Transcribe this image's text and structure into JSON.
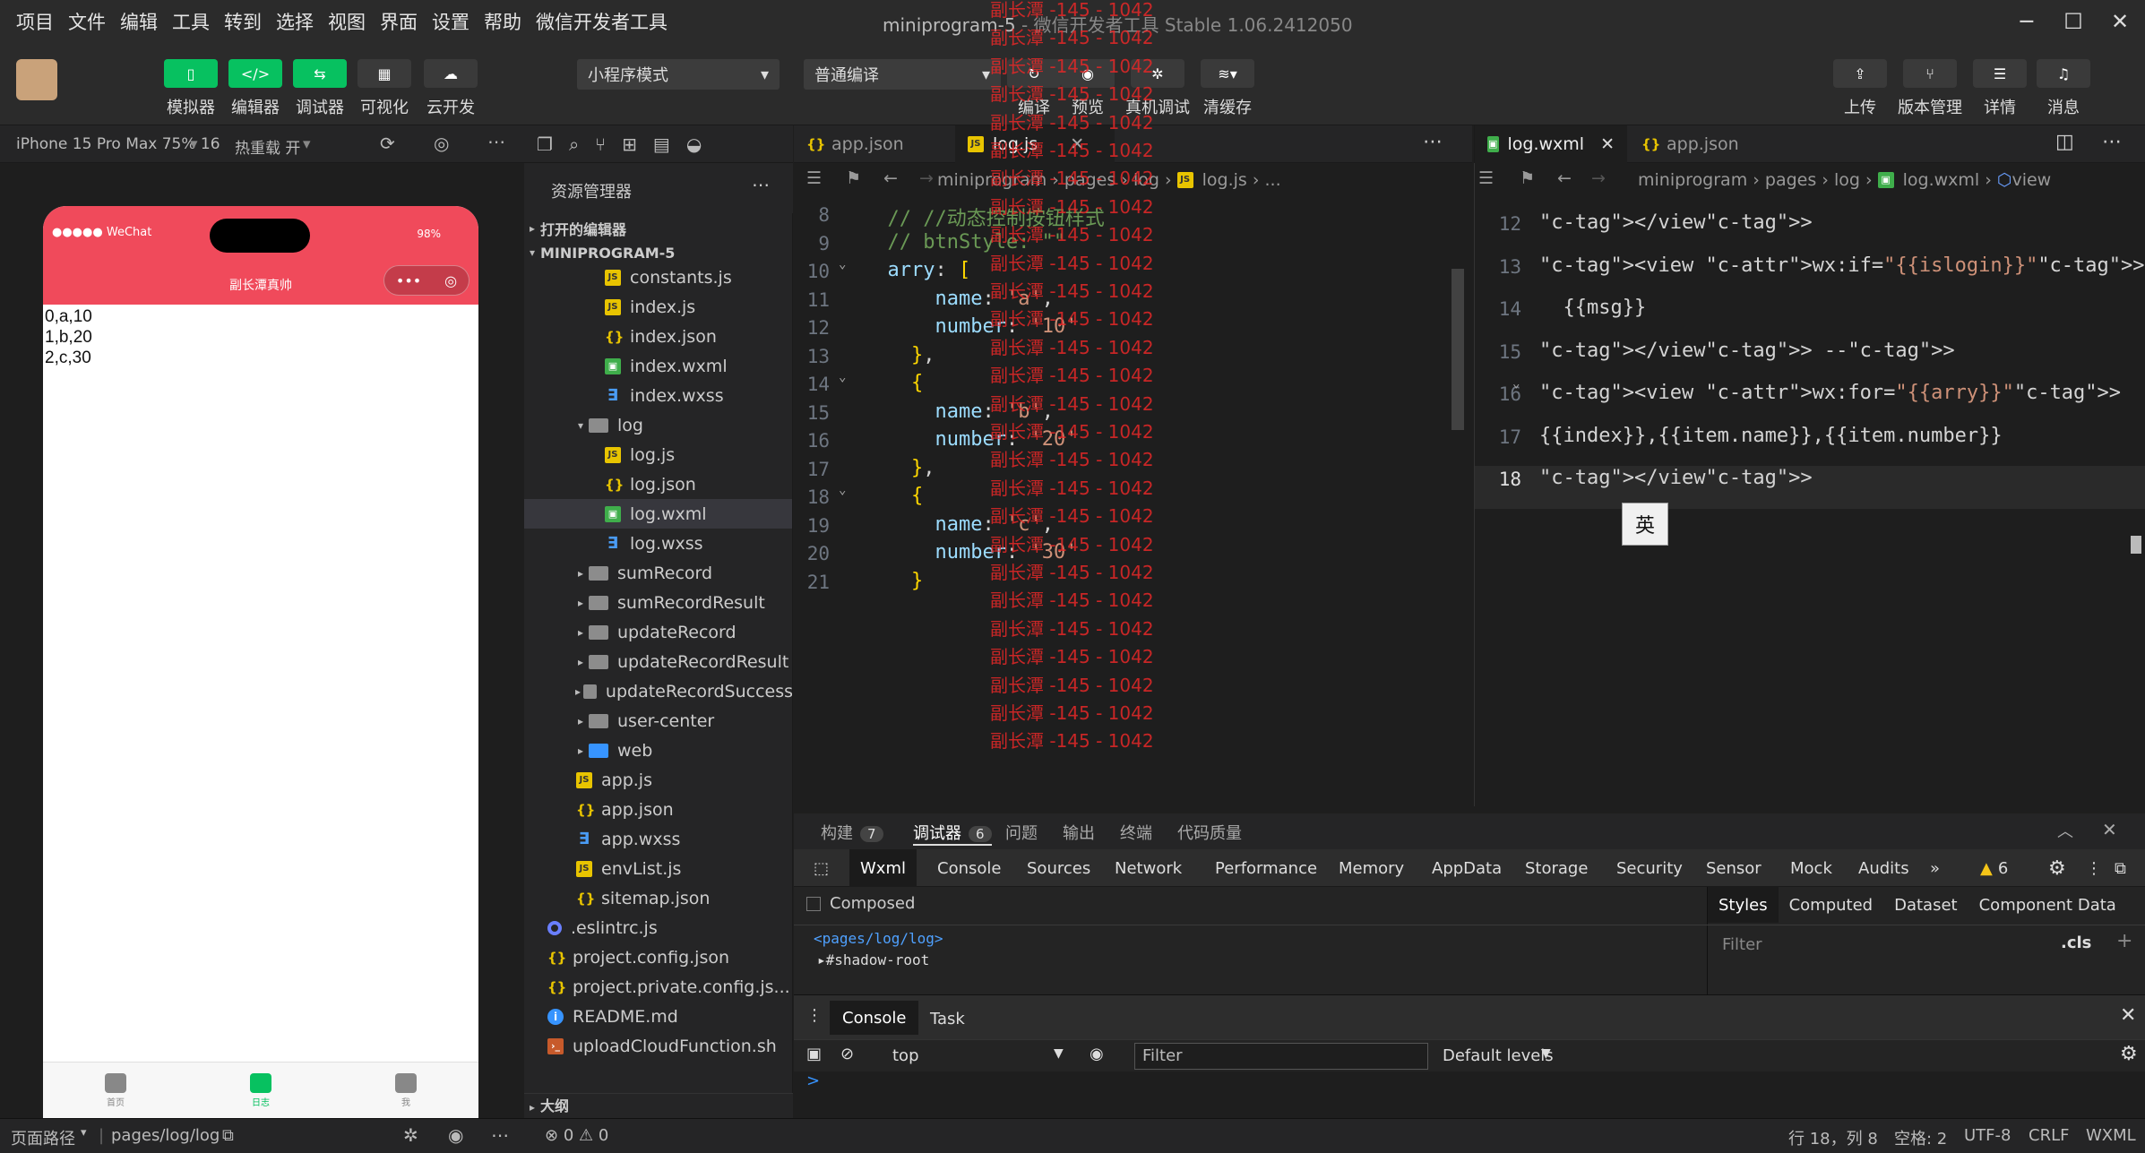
{
  "menubar": {
    "items": [
      "项目",
      "文件",
      "编辑",
      "工具",
      "转到",
      "选择",
      "视图",
      "界面",
      "设置",
      "帮助",
      "微信开发者工具"
    ],
    "title": "miniprogram-5",
    "title_sub": "- 微信开发者工具 Stable 1.06.2412050"
  },
  "toolbar": {
    "left_buttons": [
      "模拟器",
      "编辑器",
      "调试器",
      "可视化",
      "云开发"
    ],
    "mode_select": "小程序模式",
    "compile_select": "普通编译",
    "mid_buttons": [
      "编译",
      "预览",
      "真机调试",
      "清缓存"
    ],
    "right_buttons": [
      "上传",
      "版本管理",
      "详情",
      "消息"
    ]
  },
  "simulator": {
    "device": "iPhone 15 Pro Max 75% 16",
    "hot_reload": "热重载 开",
    "status_left": "●●●●● WeChat",
    "status_right": "98%",
    "nav_title": "副长潭真帅",
    "content_lines": [
      "0,a,10",
      "1,b,20",
      "2,c,30"
    ],
    "tabs": [
      {
        "label": "首页",
        "active": false
      },
      {
        "label": "日志",
        "active": true
      },
      {
        "label": "我",
        "active": false
      }
    ]
  },
  "explorer": {
    "header": "资源管理器",
    "open_editors": "打开的编辑器",
    "project": "MINIPROGRAM-5",
    "items": [
      {
        "name": "constants.js",
        "type": "js",
        "indent": 3
      },
      {
        "name": "index.js",
        "type": "js",
        "indent": 3
      },
      {
        "name": "index.json",
        "type": "json",
        "indent": 3
      },
      {
        "name": "index.wxml",
        "type": "wxml",
        "indent": 3
      },
      {
        "name": "index.wxss",
        "type": "wxss",
        "indent": 3
      },
      {
        "name": "log",
        "type": "folder-open",
        "indent": 2
      },
      {
        "name": "log.js",
        "type": "js",
        "indent": 3
      },
      {
        "name": "log.json",
        "type": "json",
        "indent": 3
      },
      {
        "name": "log.wxml",
        "type": "wxml",
        "indent": 3,
        "selected": true
      },
      {
        "name": "log.wxss",
        "type": "wxss",
        "indent": 3
      },
      {
        "name": "sumRecord",
        "type": "folder",
        "indent": 2
      },
      {
        "name": "sumRecordResult",
        "type": "folder",
        "indent": 2
      },
      {
        "name": "updateRecord",
        "type": "folder",
        "indent": 2
      },
      {
        "name": "updateRecordResult",
        "type": "folder",
        "indent": 2
      },
      {
        "name": "updateRecordSuccess",
        "type": "folder",
        "indent": 2
      },
      {
        "name": "user-center",
        "type": "folder",
        "indent": 2
      },
      {
        "name": "web",
        "type": "cloud",
        "indent": 2
      },
      {
        "name": "app.js",
        "type": "js",
        "indent": 1
      },
      {
        "name": "app.json",
        "type": "json",
        "indent": 1
      },
      {
        "name": "app.wxss",
        "type": "wxss",
        "indent": 1
      },
      {
        "name": "envList.js",
        "type": "js",
        "indent": 1
      },
      {
        "name": "sitemap.json",
        "type": "json",
        "indent": 1
      },
      {
        "name": ".eslintrc.js",
        "type": "dot",
        "indent": 0
      },
      {
        "name": "project.config.json",
        "type": "json",
        "indent": 0
      },
      {
        "name": "project.private.config.js...",
        "type": "json",
        "indent": 0
      },
      {
        "name": "README.md",
        "type": "info",
        "indent": 0
      },
      {
        "name": "uploadCloudFunction.sh",
        "type": "sh",
        "indent": 0
      }
    ],
    "outline": "大纲"
  },
  "editor1": {
    "tabs": [
      "app.json",
      "log.js"
    ],
    "crumb": [
      "miniprogram",
      "pages",
      "log",
      "log.js",
      "..."
    ],
    "lines": [
      {
        "n": "8",
        "code": "  // //动态控制按钮样式"
      },
      {
        "n": "9",
        "code": "  // btnStyle: \"\""
      },
      {
        "n": "10",
        "code": "  arry: ["
      },
      {
        "n": "11",
        "code": "      name: 'a',"
      },
      {
        "n": "12",
        "code": "      number: '10'"
      },
      {
        "n": "13",
        "code": "    },"
      },
      {
        "n": "14",
        "code": "    {"
      },
      {
        "n": "15",
        "code": "      name: 'b',"
      },
      {
        "n": "16",
        "code": "      number: '20'"
      },
      {
        "n": "17",
        "code": "    },"
      },
      {
        "n": "18",
        "code": "    {"
      },
      {
        "n": "19",
        "code": "      name: 'c',"
      },
      {
        "n": "20",
        "code": "      number: '30'"
      },
      {
        "n": "21",
        "code": "    }"
      }
    ],
    "watermark": "副长潭 -145 - 1042"
  },
  "editor2": {
    "tabs": [
      "log.wxml",
      "app.json"
    ],
    "crumb": [
      "miniprogram",
      "pages",
      "log",
      "log.wxml",
      "view"
    ],
    "lines": [
      {
        "n": "12",
        "code": "</view>"
      },
      {
        "n": "13",
        "code": "<view wx:if=\"{{islogin}}\">"
      },
      {
        "n": "14",
        "code": "  {{msg}}"
      },
      {
        "n": "15",
        "code": "</view> -->"
      },
      {
        "n": "16",
        "code": "<view wx:for=\"{{arry}}\">"
      },
      {
        "n": "17",
        "code": "{{index}},{{item.name}},{{item.number}}"
      },
      {
        "n": "18",
        "code": "</view>"
      }
    ],
    "ime": "英"
  },
  "panel": {
    "tabs": [
      {
        "label": "构建",
        "badge": "7"
      },
      {
        "label": "调试器",
        "badge": "6",
        "active": true
      },
      {
        "label": "问题"
      },
      {
        "label": "输出"
      },
      {
        "label": "终端"
      },
      {
        "label": "代码质量"
      }
    ],
    "devtools_tabs": [
      "Wxml",
      "Console",
      "Sources",
      "Network",
      "Performance",
      "Memory",
      "AppData",
      "Storage",
      "Security",
      "Sensor",
      "Mock",
      "Audits"
    ],
    "warnings": "6",
    "composed": "Composed",
    "wxml_path": "<pages/log/log>",
    "shadow_root": "#shadow-root",
    "style_tabs": [
      "Styles",
      "Computed",
      "Dataset",
      "Component Data"
    ],
    "filter_placeholder": "Filter",
    "cls": ".cls",
    "console_tabs": [
      "Console",
      "Task"
    ],
    "context": "top",
    "console_filter": "Filter",
    "levels": "Default levels",
    "prompt": ">"
  },
  "statusbar": {
    "page_path_label": "页面路径",
    "page_path": "pages/log/log",
    "errors": "0",
    "warnings": "0",
    "position": "行 18，列 8",
    "spaces": "空格: 2",
    "encoding": "UTF-8",
    "eol": "CRLF",
    "lang": "WXML"
  }
}
